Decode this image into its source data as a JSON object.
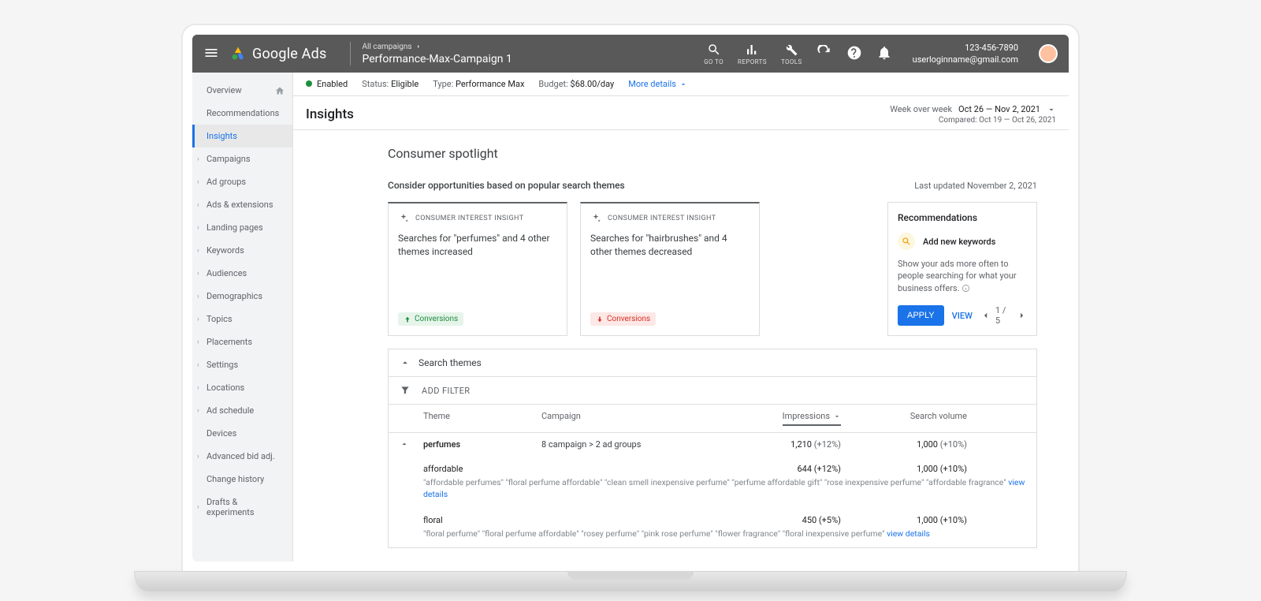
{
  "appName": "Google Ads",
  "breadcrumb": {
    "top": "All campaigns",
    "main": "Performance-Max-Campaign 1"
  },
  "topIcons": {
    "goTo": "GO TO",
    "reports": "REPORTS",
    "tools": "TOOLS"
  },
  "user": {
    "phone": "123-456-7890",
    "email": "userloginname@gmail.com"
  },
  "sidebar": {
    "items": [
      {
        "label": "Overview",
        "home": true
      },
      {
        "label": "Recommendations"
      },
      {
        "label": "Insights",
        "active": true
      },
      {
        "label": "Campaigns",
        "expandable": true
      },
      {
        "label": "Ad groups",
        "expandable": true
      },
      {
        "label": "Ads & extensions",
        "expandable": true
      },
      {
        "label": "Landing pages",
        "expandable": true
      },
      {
        "label": "Keywords",
        "expandable": true
      },
      {
        "label": "Audiences",
        "expandable": true
      },
      {
        "label": "Demographics",
        "expandable": true
      },
      {
        "label": "Topics",
        "expandable": true
      },
      {
        "label": "Placements",
        "expandable": true
      },
      {
        "label": "Settings",
        "expandable": true
      },
      {
        "label": "Locations",
        "expandable": true
      },
      {
        "label": "Ad schedule",
        "expandable": true
      },
      {
        "label": "Devices"
      },
      {
        "label": "Advanced bid adj.",
        "expandable": true
      },
      {
        "label": "Change history"
      },
      {
        "label": "Drafts & experiments",
        "expandable": true
      }
    ]
  },
  "status": {
    "enabled": "Enabled",
    "statusLabel": "Status:",
    "statusVal": "Eligible",
    "typeLabel": "Type:",
    "typeVal": "Performance Max",
    "budgetLabel": "Budget:",
    "budgetVal": "$68.00/day",
    "moreDetails": "More details"
  },
  "page": {
    "title": "Insights",
    "wow": "Week over week",
    "range": "Oct 26 — Nov 2, 2021",
    "comparedLabel": "Compared:",
    "comparedRange": "Oct 19 — Oct 26, 2021"
  },
  "spotlight": {
    "title": "Consumer spotlight",
    "subhead": "Consider opportunities based on popular search themes",
    "lastUpdated": "Last updated November 2, 2021",
    "insightLabel": "CONSUMER INTEREST INSIGHT",
    "card1": {
      "text": "Searches for \"perfumes\" and 4 other themes increased",
      "badge": "Conversions"
    },
    "card2": {
      "text": "Searches for \"hairbrushes\" and 4 other themes decreased",
      "badge": "Conversions"
    }
  },
  "recs": {
    "title": "Recommendations",
    "keywordTitle": "Add new keywords",
    "desc": "Show your ads more often to people searching for what your business offers.",
    "apply": "APPLY",
    "view": "VIEW",
    "pager": "1 / 5"
  },
  "themes": {
    "panelTitle": "Search themes",
    "addFilter": "ADD FILTER",
    "cols": {
      "theme": "Theme",
      "campaign": "Campaign",
      "impressions": "Impressions",
      "volume": "Search volume"
    },
    "rows": [
      {
        "theme": "perfumes",
        "campaign": "8 campaign > 2 ad groups",
        "impressions": "1,210",
        "impDelta": "(+12%)",
        "volume": "1,000",
        "volDelta": "(+10%)",
        "sub": [
          {
            "title": "affordable",
            "impressions": "644",
            "impDelta": "(+12%)",
            "volume": "1,000",
            "volDelta": "(+10%)",
            "details": "\"affordable perfumes\" \"floral perfume affordable\" \"clean smell inexpensive perfume\" \"perfume affordable gift\" \"rose inexpensive perfume\" \"affordable fragrance\"",
            "link": "view details"
          },
          {
            "title": "floral",
            "impressions": "450",
            "impDelta": "(+5%)",
            "volume": "1,000",
            "volDelta": "(+10%)",
            "details": "\"floral perfume\" \"floral perfume affordable\" \"rosey perfume\" \"pink rose perfume\" \"flower fragrance\" \"floral inexpensive perfume\"",
            "link": "view details"
          }
        ]
      }
    ]
  }
}
